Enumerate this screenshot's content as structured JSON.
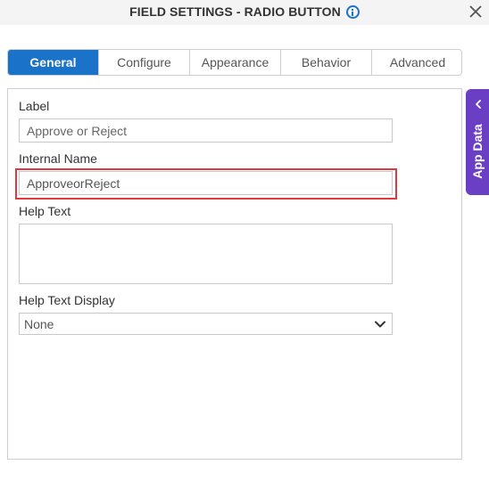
{
  "dialog": {
    "title": "FIELD SETTINGS - RADIO BUTTON",
    "info_icon": "info-icon",
    "close_icon": "close-icon"
  },
  "tabs": [
    {
      "label": "General",
      "active": true
    },
    {
      "label": "Configure",
      "active": false
    },
    {
      "label": "Appearance",
      "active": false
    },
    {
      "label": "Behavior",
      "active": false
    },
    {
      "label": "Advanced",
      "active": false
    }
  ],
  "form": {
    "label_caption": "Label",
    "label_value": "Approve or Reject",
    "internal_name_caption": "Internal Name",
    "internal_name_value": "ApproveorReject",
    "help_text_caption": "Help Text",
    "help_text_value": "",
    "help_text_display_caption": "Help Text Display",
    "help_text_display_value": "None"
  },
  "side_panel": {
    "label": "App Data",
    "icon": "chevron-left-icon"
  },
  "colors": {
    "accent": "#1a73c9",
    "side_panel": "#6b3fc4",
    "highlight": "#e0393e"
  }
}
